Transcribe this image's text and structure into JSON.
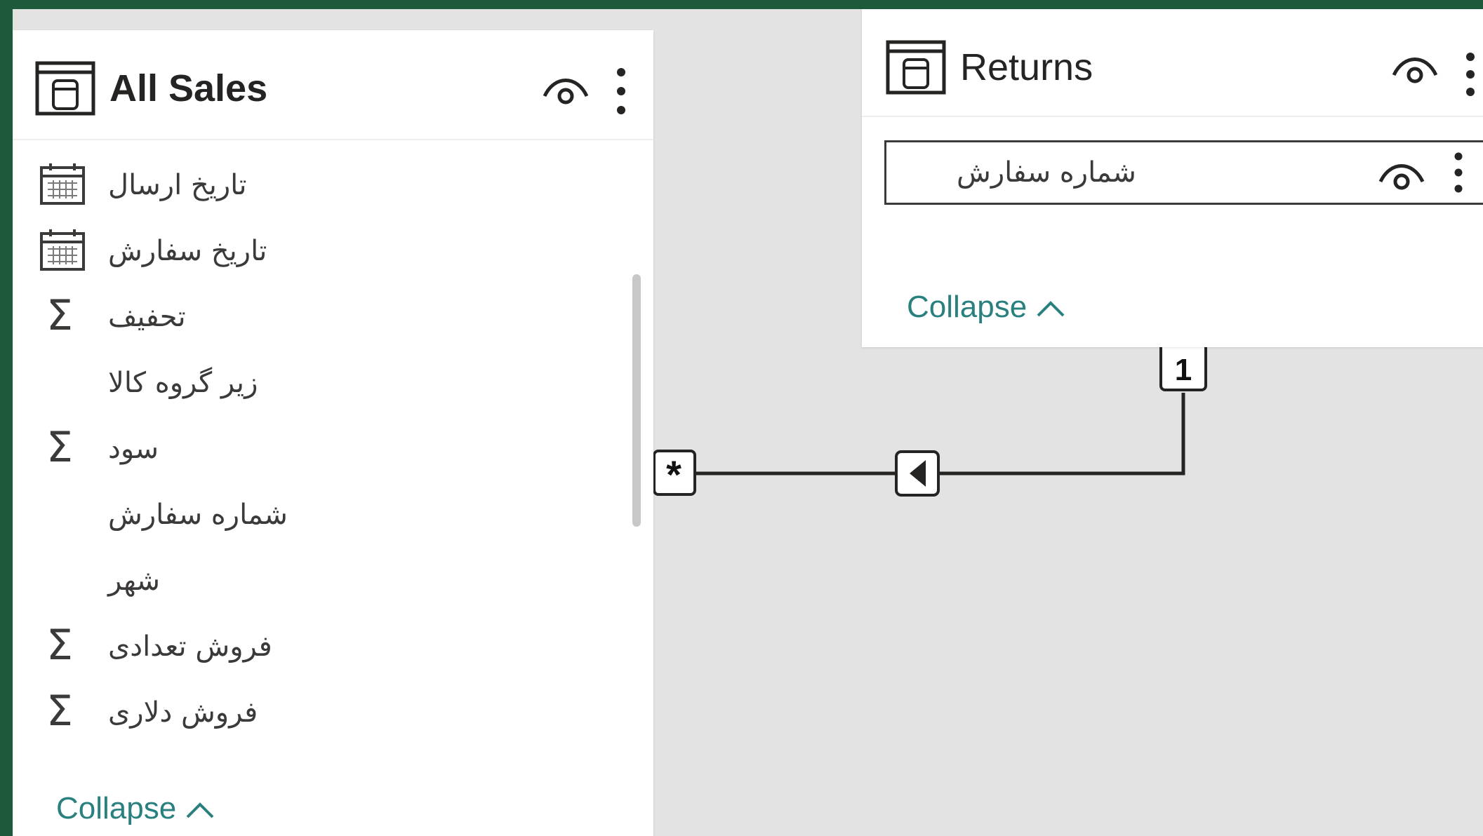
{
  "all_sales": {
    "title": "All Sales",
    "fields": [
      {
        "label": "تاریخ ارسال",
        "icon": "calendar-icon"
      },
      {
        "label": "تاریخ سفارش",
        "icon": "calendar-icon"
      },
      {
        "label": "تحفیف",
        "icon": "sigma-icon"
      },
      {
        "label": "زیر گروه کالا",
        "icon": ""
      },
      {
        "label": "سود",
        "icon": "sigma-icon"
      },
      {
        "label": "شماره سفارش",
        "icon": ""
      },
      {
        "label": "شهر",
        "icon": ""
      },
      {
        "label": "فروش تعدادی",
        "icon": "sigma-icon"
      },
      {
        "label": "فروش دلاری",
        "icon": "sigma-icon"
      }
    ],
    "collapse_label": "Collapse"
  },
  "returns": {
    "title": "Returns",
    "fields": [
      {
        "label": "شماره سفارش",
        "icon": ""
      }
    ],
    "collapse_label": "Collapse"
  },
  "relationship": {
    "many_side_label": "*",
    "one_side_label": "1",
    "direction": "single",
    "line_color": "#252423"
  },
  "colors": {
    "frame": "#1d5a3c",
    "canvas": "#e3e3e3",
    "accent": "#2a7f7f"
  }
}
